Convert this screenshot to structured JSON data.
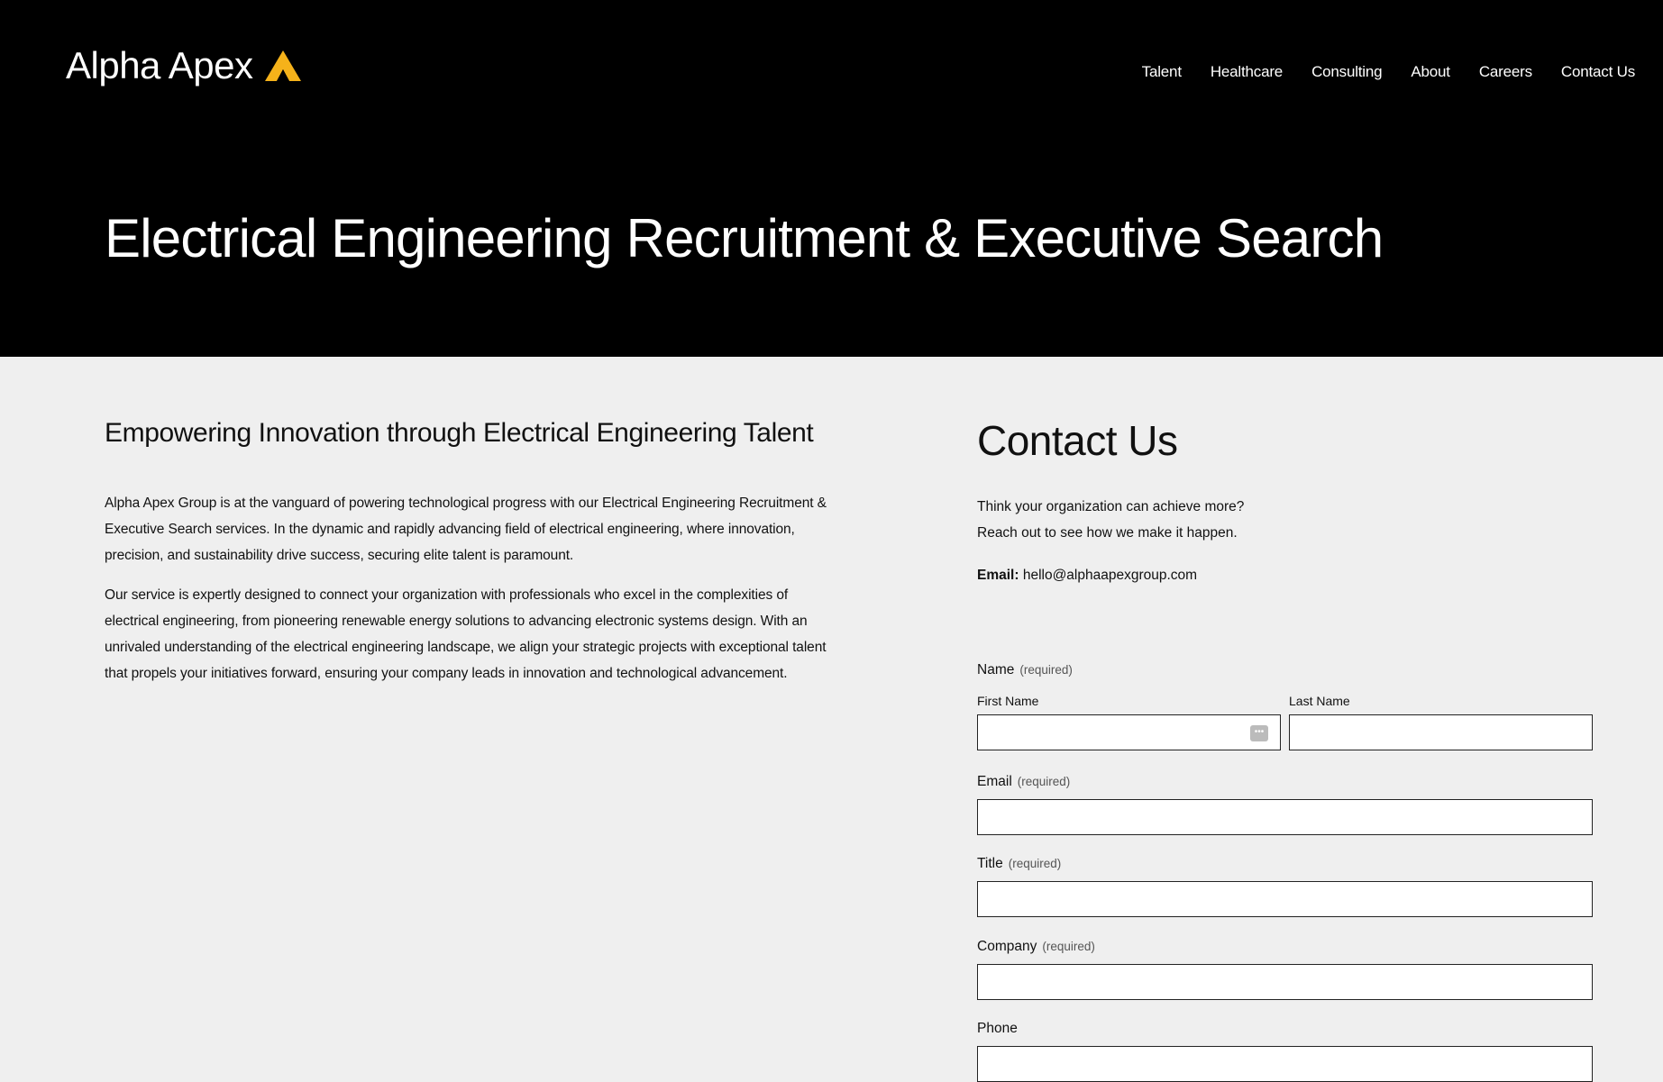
{
  "brand": {
    "name": "Alpha Apex",
    "mark_color": "#F5B21A"
  },
  "nav": {
    "items": [
      {
        "label": "Talent"
      },
      {
        "label": "Healthcare"
      },
      {
        "label": "Consulting"
      },
      {
        "label": "About"
      },
      {
        "label": "Careers"
      },
      {
        "label": "Contact Us"
      }
    ]
  },
  "hero": {
    "title": "Electrical Engineering Recruitment & Executive Search"
  },
  "main": {
    "heading": "Empowering Innovation through Electrical Engineering Talent",
    "paragraphs": [
      "Alpha Apex Group is at the vanguard of powering technological progress with our Electrical Engineering Recruitment & Executive Search services. In the dynamic and rapidly advancing field of electrical engineering, where innovation, precision, and sustainability drive success, securing elite talent is paramount.",
      "Our service is expertly designed to connect your organization with professionals who excel in the complexities of electrical engineering, from pioneering renewable energy solutions to advancing electronic systems design. With an unrivaled understanding of the electrical engineering landscape, we align your strategic projects with exceptional talent that propels your initiatives forward, ensuring your company leads in innovation and technological advancement."
    ]
  },
  "contact": {
    "heading": "Contact Us",
    "intro_line1": "Think your organization can achieve more?",
    "intro_line2": "Reach out to see how we make it happen.",
    "email_label": "Email:",
    "email_value": "hello@alphaapexgroup.com",
    "form": {
      "required_text": "(required)",
      "name_label": "Name",
      "first_name_label": "First Name",
      "first_name_value": "",
      "last_name_label": "Last Name",
      "last_name_value": "",
      "email_label": "Email",
      "email_value": "",
      "title_label": "Title",
      "title_value": "",
      "company_label": "Company",
      "company_value": "",
      "phone_label": "Phone",
      "phone_value": ""
    }
  }
}
